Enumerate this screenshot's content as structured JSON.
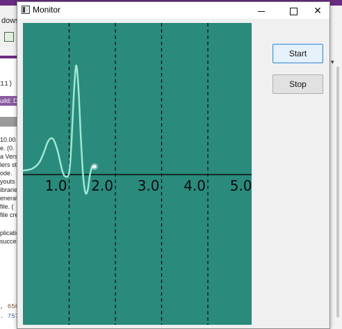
{
  "background_app": {
    "menu_partial": "dows",
    "code_fragment": "11)",
    "build_partial": "uild: D",
    "log_lines": [
      "10.00",
      "e.  (0.",
      "a Versi",
      "lers st",
      "ode.",
      "youts",
      "ibrarie",
      "enerat",
      "file.  (",
      "file cre",
      "",
      "plicatio",
      "succes"
    ],
    "bottom_code": [
      ", 656",
      ". 757"
    ]
  },
  "window": {
    "title": "Monitor",
    "controls": [
      "minimize",
      "maximize",
      "close"
    ]
  },
  "buttons": {
    "start_label": "Start",
    "stop_label": "Stop"
  },
  "colors": {
    "plot_background": "#2a8a7b",
    "signal_line": "#a8f0dc",
    "axis": "#0c0c0c",
    "accent_focus": "#3c8fd8"
  },
  "chart_data": {
    "type": "line",
    "title": "",
    "xlabel": "",
    "ylabel": "",
    "x_ticks": [
      "1.0",
      "2.0",
      "3.0",
      "4.0",
      "5.0"
    ],
    "xlim": [
      0.0,
      5.0
    ],
    "ylim": [
      -1.0,
      3.0
    ],
    "grid": "vertical dashed lines at each x tick",
    "series": [
      {
        "x": [
          0.0,
          0.2,
          0.35,
          0.45,
          0.55,
          0.65,
          0.75,
          0.85,
          0.92,
          1.0,
          1.05,
          1.1,
          1.15,
          1.2,
          1.25,
          1.3,
          1.35,
          1.4,
          1.45,
          1.5,
          1.55
        ],
        "values": [
          0.1,
          0.15,
          0.3,
          0.55,
          0.85,
          0.9,
          0.6,
          0.1,
          -0.05,
          0.05,
          0.8,
          2.0,
          2.75,
          2.2,
          1.0,
          0.0,
          -0.45,
          -0.4,
          0.0,
          0.2,
          0.2
        ]
      }
    ]
  }
}
